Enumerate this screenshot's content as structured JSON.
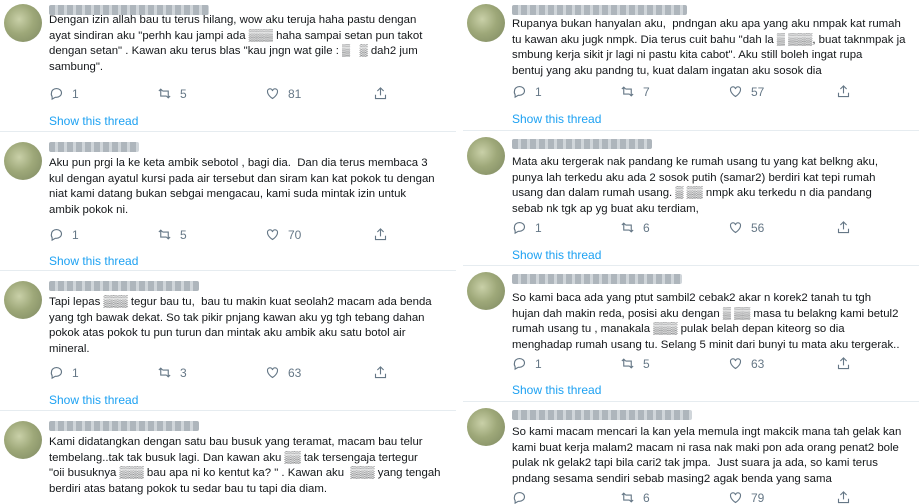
{
  "show_thread_label": "Show this thread",
  "colors": {
    "link": "#1da1f2",
    "muted": "#657786",
    "text": "#14171a",
    "divider": "#e6ecf0"
  },
  "left": [
    {
      "text": "Dengan izin allah bau tu terus hilang, wow aku teruja haha pastu dengan\nayat sindiran aku \"perhh kau jampi ada ▒▒▒ haha sampai setan pun takot\ndengan setan\" . Kawan aku terus blas \"kau jngn wat gile : ▒   ▒ dah2 jum\nsambung\".",
      "replies": "1",
      "retweets": "5",
      "likes": "81"
    },
    {
      "text": "Aku pun prgi la ke keta ambik sebotol , bagi dia.  Dan dia terus membaca 3\nkul dengan ayatul kursi pada air tersebut dan siram kan kat pokok tu dengan\nniat kami datang bukan sebgai mengacau, kami suda mintak izin untuk\nambik pokok ni.",
      "replies": "1",
      "retweets": "5",
      "likes": "70"
    },
    {
      "text": "Tapi lepas ▒▒▒ tegur bau tu,  bau tu makin kuat seolah2 macam ada benda\nyang tgh bawak dekat. So tak pikir pnjang kawan aku yg tgh tebang dahan\npokok atas pokok tu pun turun dan mintak aku ambik aku satu botol air\nmineral.",
      "replies": "1",
      "retweets": "3",
      "likes": "63"
    },
    {
      "text": "Kami didatangkan dengan satu bau busuk yang teramat, macam bau telur\ntembelang..tak tak busuk lagi. Dan kawan aku ▒▒ tak tersengaja tertegur\n\"oii busuknya ▒▒▒ bau apa ni ko kentut ka? \" . Kawan aku  ▒▒▒ yang tengah\nberdiri atas batang pokok tu sedar bau tu tapi dia diam.",
      "replies": "",
      "retweets": "",
      "likes": ""
    }
  ],
  "right": [
    {
      "text": "Rupanya bukan hanyalan aku,  pndngan aku apa yang aku nmpak kat rumah\ntu kawan aku jugk nmpk. Dia terus cuit bahu \"dah la ▒ ▒▒▒, buat taknmpak ja\nsmbung kerja sikit jr lagi ni pastu kita cabot\". Aku still boleh ingat rupa\nbentuj yang aku pandng tu, kuat dalam ingatan aku sosok dia",
      "replies": "1",
      "retweets": "7",
      "likes": "57"
    },
    {
      "text": "Mata aku tergerak nak pandang ke rumah usang tu yang kat belkng aku,\npunya lah terkedu aku ada 2 sosok putih (samar2) berdiri kat tepi rumah\nusang dan dalam rumah usang. ▒ ▒▒ nmpk aku terkedu n dia pandang\nsebab nk tgk ap yg buat aku terdiam,",
      "replies": "1",
      "retweets": "6",
      "likes": "56"
    },
    {
      "text": "So kami baca ada yang ptut sambil2 cebak2 akar n korek2 tanah tu tgh\nhujan dah makin reda, posisi aku dengan ▒ ▒▒ masa tu belakng kami betul2\nrumah usang tu , manakala ▒▒▒ pulak belah depan kiteorg so dia\nmenghadap rumah usang tu. Selang 5 minit dari bunyi tu mata aku tergerak..",
      "replies": "1",
      "retweets": "5",
      "likes": "63"
    },
    {
      "text": "So kami macam mencari la kan yela memula ingt makcik mana tah gelak kan\nkami buat kerja malam2 macam ni rasa nak maki pon ada orang penat2 bole\npulak nk gelak2 tapi bila cari2 tak jmpa.  Just suara ja ada, so kami terus\npndang sesama sendiri sebab masing2 agak benda yang sama",
      "replies": "",
      "retweets": "6",
      "likes": "79"
    }
  ]
}
